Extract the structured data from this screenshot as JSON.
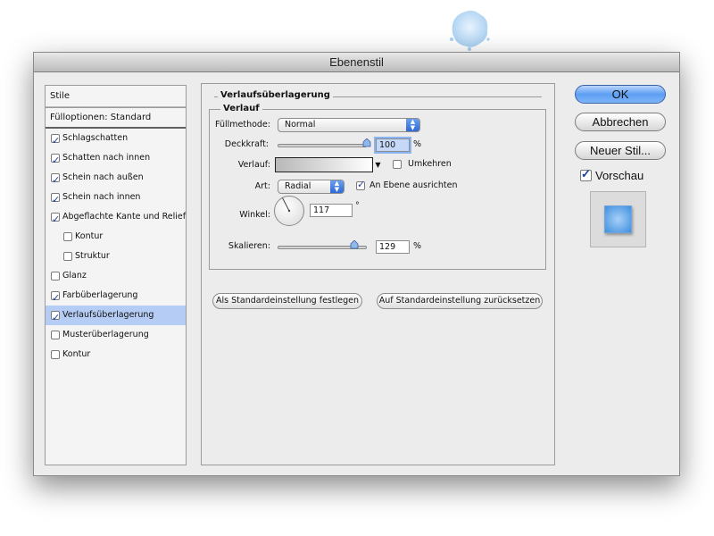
{
  "window": {
    "title": "Ebenenstil"
  },
  "stylelist": {
    "header": "Stile",
    "blend_options": "Fülloptionen: Standard",
    "items": [
      {
        "label": "Schlagschatten",
        "checked": true,
        "sub": false,
        "selected": false
      },
      {
        "label": "Schatten nach innen",
        "checked": true,
        "sub": false,
        "selected": false
      },
      {
        "label": "Schein nach außen",
        "checked": true,
        "sub": false,
        "selected": false
      },
      {
        "label": "Schein nach innen",
        "checked": true,
        "sub": false,
        "selected": false
      },
      {
        "label": "Abgeflachte Kante und Relief",
        "checked": true,
        "sub": false,
        "selected": false
      },
      {
        "label": "Kontur",
        "checked": false,
        "sub": true,
        "selected": false
      },
      {
        "label": "Struktur",
        "checked": false,
        "sub": true,
        "selected": false
      },
      {
        "label": "Glanz",
        "checked": false,
        "sub": false,
        "selected": false
      },
      {
        "label": "Farbüberlagerung",
        "checked": true,
        "sub": false,
        "selected": false
      },
      {
        "label": "Verlaufsüberlagerung",
        "checked": true,
        "sub": false,
        "selected": true
      },
      {
        "label": "Musterüberlagerung",
        "checked": false,
        "sub": false,
        "selected": false
      },
      {
        "label": "Kontur",
        "checked": false,
        "sub": false,
        "selected": false
      }
    ]
  },
  "panel": {
    "title": "Verlaufsüberlagerung",
    "subtitle": "Verlauf",
    "blend_mode_label": "Füllmethode:",
    "blend_mode_value": "Normal",
    "opacity_label": "Deckkraft:",
    "opacity_value": "100",
    "opacity_level": 1.0,
    "percent": "%",
    "gradient_label": "Verlauf:",
    "reverse_label": "Umkehren",
    "reverse_checked": false,
    "style_label": "Art:",
    "style_value": "Radial",
    "align_label": "An Ebene ausrichten",
    "align_checked": true,
    "angle_label": "Winkel:",
    "angle_value": "117",
    "degree": "°",
    "scale_label": "Skalieren:",
    "scale_value": "129",
    "scale_level": 0.86,
    "make_default": "Als Standardeinstellung festlegen",
    "reset_default": "Auf Standardeinstellung zurücksetzen"
  },
  "buttons": {
    "ok": "OK",
    "cancel": "Abbrechen",
    "new_style": "Neuer Stil...",
    "preview_label": "Vorschau",
    "preview_checked": true
  },
  "colors": {
    "accent": "#5d9ef3",
    "selection": "#b5cdf5",
    "preview_fill": "#3f8fdf"
  }
}
